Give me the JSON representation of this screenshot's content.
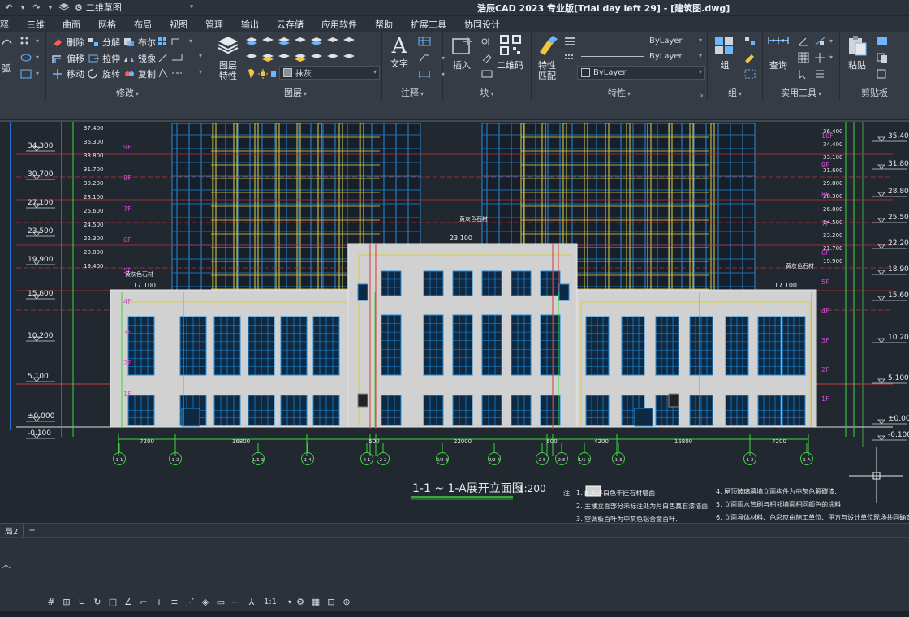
{
  "app": {
    "title": "浩辰CAD 2023 专业版[Trial day left 29] - [建筑图.dwg]",
    "workspace": "二维草图"
  },
  "menu": [
    "释",
    "三维",
    "曲面",
    "网格",
    "布局",
    "视图",
    "管理",
    "输出",
    "云存储",
    "应用软件",
    "帮助",
    "扩展工具",
    "协同设计"
  ],
  "ribbon": {
    "draw_partial": [
      "弧"
    ],
    "modify": {
      "title": "修改",
      "tools": [
        "删除",
        "分解",
        "布尔",
        "偏移",
        "拉伸",
        "镜像",
        "移动",
        "旋转",
        "复制"
      ]
    },
    "layer": {
      "title": "图层",
      "big_label_1": "图层",
      "big_label_2": "特性",
      "layer_combo": "抹灰"
    },
    "annotation": {
      "title": "注释",
      "text_label": "文字"
    },
    "block": {
      "title": "块",
      "insert_label": "插入",
      "qrcode_label": "二维码"
    },
    "properties": {
      "title": "特性",
      "match_label_1": "特性",
      "match_label_2": "匹配",
      "bylayer_1": "ByLayer",
      "bylayer_2": "ByLayer",
      "bylayer_3": "ByLayer"
    },
    "group": {
      "title": "组",
      "label": "组"
    },
    "utilities": {
      "title": "实用工具",
      "query_label": "查询"
    },
    "clipboard": {
      "title": "剪贴板",
      "paste_label": "粘贴"
    }
  },
  "drawing": {
    "elev_left": [
      "34.300",
      "30.700",
      "27.100",
      "23.500",
      "19.900",
      "15.600",
      "10.200",
      "5.100",
      "±0.000",
      "-0.100"
    ],
    "elev_right": [
      "35.400",
      "31.800",
      "28.800",
      "25.500",
      "22.200",
      "18.900",
      "15.600",
      "10.200",
      "5.100",
      "±0.000",
      "-0.100"
    ],
    "floor_levels_left": [
      "37.400",
      "36.300",
      "33.800",
      "31.700",
      "30.200",
      "28.100",
      "26.600",
      "24.500",
      "22.300",
      "20.800",
      "19.400"
    ],
    "floor_levels_right": [
      "36.400",
      "34.400",
      "33.100",
      "31.600",
      "29.800",
      "28.300",
      "26.000",
      "24.500",
      "23.200",
      "21.700",
      "19.900"
    ],
    "floors": [
      "9F",
      "8F",
      "7F",
      "6F",
      "5F",
      "4F",
      "3F",
      "2F",
      "1F"
    ],
    "floors_right": [
      "10F",
      "9F",
      "8F",
      "7F",
      "6F",
      "5F",
      "4F",
      "3F",
      "2F",
      "1F"
    ],
    "roof_levels": [
      "17.100",
      "23.100",
      "17.100"
    ],
    "roof_notes": [
      "黄灰色石材",
      "黄灰色石材",
      "黄灰色石材"
    ],
    "dims": [
      "7200",
      "16800",
      "500",
      "22000",
      "500",
      "4200",
      "16800",
      "7200"
    ],
    "axis_marks": [
      "1-1",
      "1-2",
      "1/1-3",
      "1-4",
      "2-1",
      "2-2",
      "2/2-3",
      "2/2-4",
      "2-5",
      "2-6",
      "1/1-5",
      "1-3",
      "1-2",
      "1-A"
    ],
    "drawing_title": "1-1 ~ 1-A展开立面图",
    "scale": "1:200",
    "notes_label": "注:",
    "notes": [
      "1. ▮ 素平白色干挂石材墙面",
      "2. 主楼立面部分未标注处为月白色真石漆墙面",
      "3. 空调板百叶为中灰色铝合金百叶.",
      "4. 屋顶玻璃幕墙立面构件为中灰色氟碳漆.",
      "5. 立面雨水管刷与相邻墙面相同颜色的涂料.",
      "6. 立面具体材料、色彩应由施工单位、甲方与设计单位现场共同确定."
    ]
  },
  "layout_tabs": [
    "局2",
    "+"
  ],
  "command": {
    "prompt": "个"
  },
  "status": {
    "scale": "1:1"
  }
}
